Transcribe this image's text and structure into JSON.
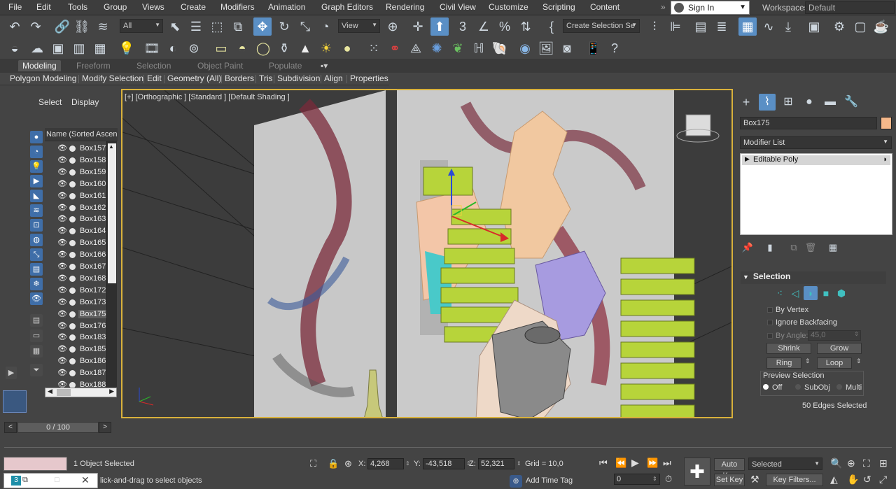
{
  "menu": [
    "File",
    "Edit",
    "Tools",
    "Group",
    "Views",
    "Create",
    "Modifiers",
    "Animation",
    "Graph Editors",
    "Rendering",
    "Civil View",
    "Customize",
    "Scripting",
    "Content"
  ],
  "sign_in": "Sign In",
  "workspaces": {
    "label": "Workspaces:",
    "value": "Default"
  },
  "toolbar": {
    "filter": "All",
    "ref_coord": "View",
    "named_selection": "Create Selection Se"
  },
  "ribbon": {
    "tabs": [
      "Modeling",
      "Freeform",
      "Selection",
      "Object Paint",
      "Populate"
    ],
    "active": "Modeling",
    "items": [
      "Polygon Modeling",
      "Modify Selection",
      "Edit",
      "Geometry (All)",
      "Borders",
      "Tris",
      "Subdivision",
      "Align",
      "Properties"
    ]
  },
  "explorer": {
    "tabs": [
      "Select",
      "Display"
    ],
    "column": "Name (Sorted Ascendi",
    "rows": [
      "Box157",
      "Box158",
      "Box159",
      "Box160",
      "Box161",
      "Box162",
      "Box163",
      "Box164",
      "Box165",
      "Box166",
      "Box167",
      "Box168",
      "Box172",
      "Box173",
      "Box175",
      "Box176",
      "Box183",
      "Box185",
      "Box186",
      "Box187",
      "Box188"
    ],
    "selected": "Box175"
  },
  "viewport": {
    "label": "[+] [Orthographic ] [Standard ] [Default Shading ]"
  },
  "command_panel": {
    "object_name": "Box175",
    "object_color": "#f5b88a",
    "modifier_list": "Modifier List",
    "stack": [
      "Editable Poly"
    ],
    "rollout": "Selection",
    "by_vertex": "By Vertex",
    "ignore_backfacing": "Ignore Backfacing",
    "by_angle": "By Angle:",
    "angle_value": "45,0",
    "shrink": "Shrink",
    "grow": "Grow",
    "ring": "Ring",
    "loop": "Loop",
    "preview_label": "Preview Selection",
    "preview_options": [
      "Off",
      "SubObj",
      "Multi"
    ],
    "preview_selected": "Off",
    "status": "50 Edges Selected"
  },
  "timeline": {
    "frame": "0 / 100"
  },
  "status": {
    "objects": "1 Object Selected",
    "prompt": "lick-and-drag to select objects",
    "x_label": "X:",
    "x": "4,268",
    "y_label": "Y:",
    "y": "-43,518",
    "z_label": "Z:",
    "z": "52,321",
    "grid": "Grid = 10,0",
    "add_time_tag": "Add Time Tag",
    "auto_key": "Auto Key",
    "set_key": "Set Key",
    "selected": "Selected",
    "frame_field": "0",
    "key_filters": "Key Filters..."
  }
}
